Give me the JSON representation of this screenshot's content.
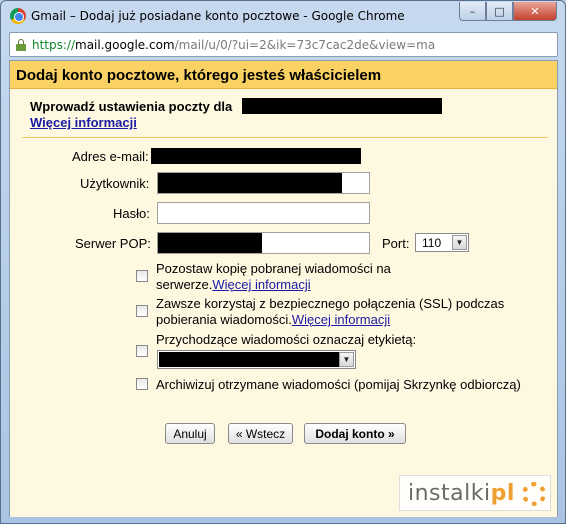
{
  "window": {
    "title": "Gmail – Dodaj już posiadane konto pocztowe - Google Chrome",
    "controls": {
      "minimize": "–",
      "maximize": "□",
      "close": "✕"
    }
  },
  "address_bar": {
    "scheme": "https://",
    "host": "mail.google.com",
    "path": "/mail/u/0/?ui=2&ik=73c7cac2de&view=ma"
  },
  "dialog": {
    "header": "Dodaj konto pocztowe, którego jesteś właścicielem",
    "intro": "Wprowadź ustawienia poczty dla",
    "more_info": "Więcej informacji",
    "fields": {
      "email_label": "Adres e-mail:",
      "username_label": "Użytkownik:",
      "password_label": "Hasło:",
      "pop_server_label": "Serwer POP:",
      "port_label": "Port:",
      "port_value": "110"
    },
    "options": {
      "leave_copy": "Pozostaw kopię pobranej wiadomości na serwerze.",
      "leave_copy_link": "Więcej informacji",
      "ssl_line1": "Zawsze korzystaj z bezpiecznego połączenia (SSL) podczas",
      "ssl_line2": "pobierania wiadomości.",
      "ssl_link": "Więcej informacji",
      "label_incoming": "Przychodzące wiadomości oznaczaj etykietą:",
      "archive": "Archiwizuj otrzymane wiadomości (pomijaj Skrzynkę odbiorczą)"
    },
    "buttons": {
      "cancel": "Anuluj",
      "back": "« Wstecz",
      "add_account": "Dodaj konto »"
    }
  },
  "watermark": {
    "text": "instalki",
    "suffix": "pl"
  }
}
